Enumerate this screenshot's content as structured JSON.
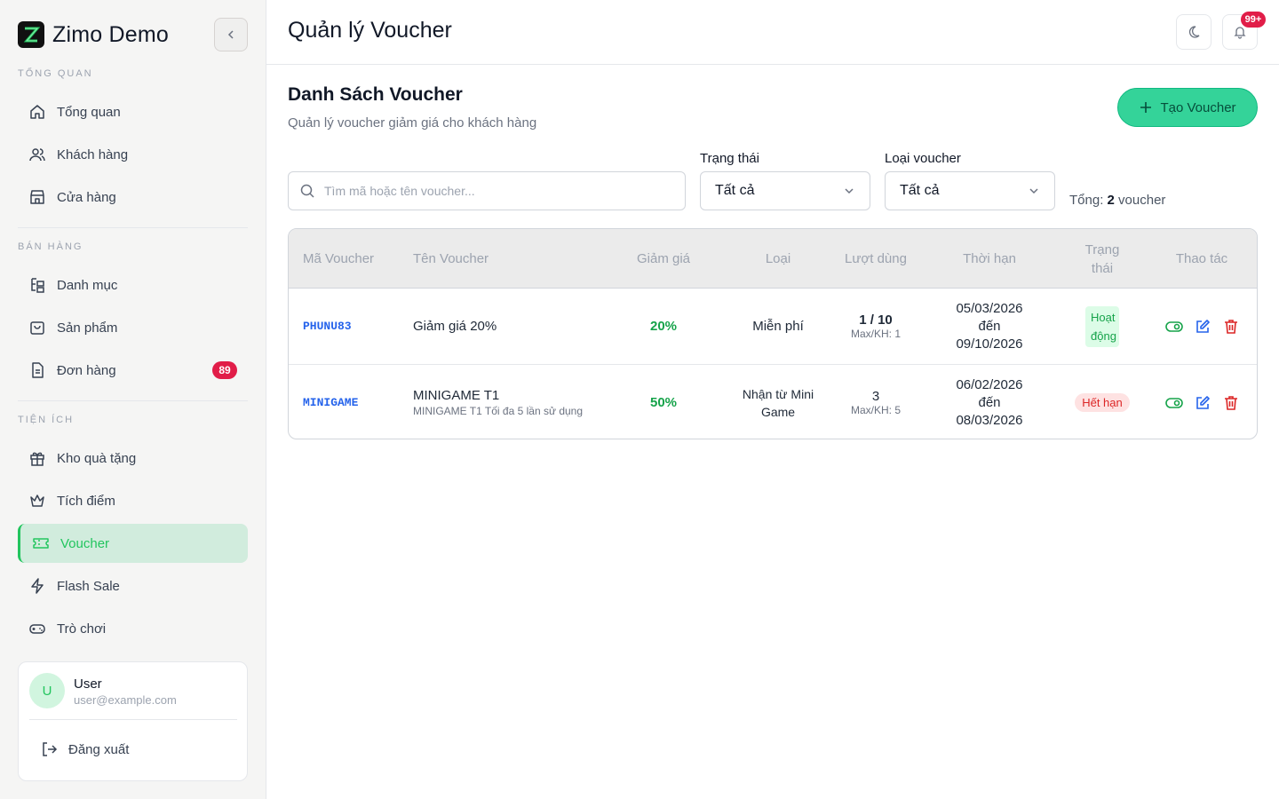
{
  "brand": {
    "name": "Zimo Demo"
  },
  "sidebar": {
    "sections": [
      {
        "title": "TỔNG QUAN"
      },
      {
        "title": "BÁN HÀNG"
      },
      {
        "title": "TIỆN ÍCH"
      }
    ],
    "items": [
      {
        "label": "Tổng quan",
        "icon": "home-icon"
      },
      {
        "label": "Khách hàng",
        "icon": "users-icon"
      },
      {
        "label": "Cửa hàng",
        "icon": "store-icon"
      },
      {
        "label": "Danh mục",
        "icon": "category-tree-icon"
      },
      {
        "label": "Sản phẩm",
        "icon": "shopping-bag-icon"
      },
      {
        "label": "Đơn hàng",
        "icon": "document-icon",
        "badge": "89"
      },
      {
        "label": "Kho quà tặng",
        "icon": "gift-icon"
      },
      {
        "label": "Tích điểm",
        "icon": "crown-icon"
      },
      {
        "label": "Voucher",
        "icon": "ticket-icon",
        "active": true
      },
      {
        "label": "Flash Sale",
        "icon": "lightning-icon"
      },
      {
        "label": "Trò chơi",
        "icon": "gamepad-icon"
      }
    ],
    "user": {
      "initial": "U",
      "name": "User",
      "email": "user@example.com",
      "logout_label": "Đăng xuất"
    }
  },
  "header": {
    "title": "Quản lý Voucher",
    "notification_count": "99+"
  },
  "main": {
    "title": "Danh Sách Voucher",
    "subtitle": "Quản lý voucher giảm giá cho khách hàng",
    "create_button_label": "Tạo Voucher",
    "search_placeholder": "Tìm mã hoặc tên voucher...",
    "filters": {
      "status": {
        "label": "Trạng thái",
        "value": "Tất cả"
      },
      "type": {
        "label": "Loại voucher",
        "value": "Tất cả"
      }
    },
    "total": {
      "prefix": "Tổng:",
      "count": "2",
      "suffix": "voucher"
    }
  },
  "table": {
    "headers": [
      "Mã Voucher",
      "Tên Voucher",
      "Giảm giá",
      "Loại",
      "Lượt dùng",
      "Thời hạn",
      "Trạng thái",
      "Thao tác"
    ],
    "rows": [
      {
        "code": "PHUNU83",
        "name": "Giảm giá 20%",
        "description": "",
        "discount": "20%",
        "type": "Miễn phí",
        "usage": "1 / 10",
        "usage_max": "Max/KH: 1",
        "start": "05/03/2026",
        "to": "đến",
        "end": "09/10/2026",
        "status": "Hoạt động",
        "status_kind": "active"
      },
      {
        "code": "MINIGAME",
        "name": "MINIGAME T1",
        "description": "MINIGAME T1 Tối đa 5 lần sử dụng",
        "discount": "50%",
        "type": "Nhận từ Mini Game",
        "usage": "3",
        "usage_max": "Max/KH: 5",
        "start": "06/02/2026",
        "to": "đến",
        "end": "08/03/2026",
        "status": "Hết hạn",
        "status_kind": "expired"
      }
    ]
  },
  "colors": {
    "accent": "#22c55e",
    "danger": "#e11d48",
    "link": "#2563eb"
  }
}
